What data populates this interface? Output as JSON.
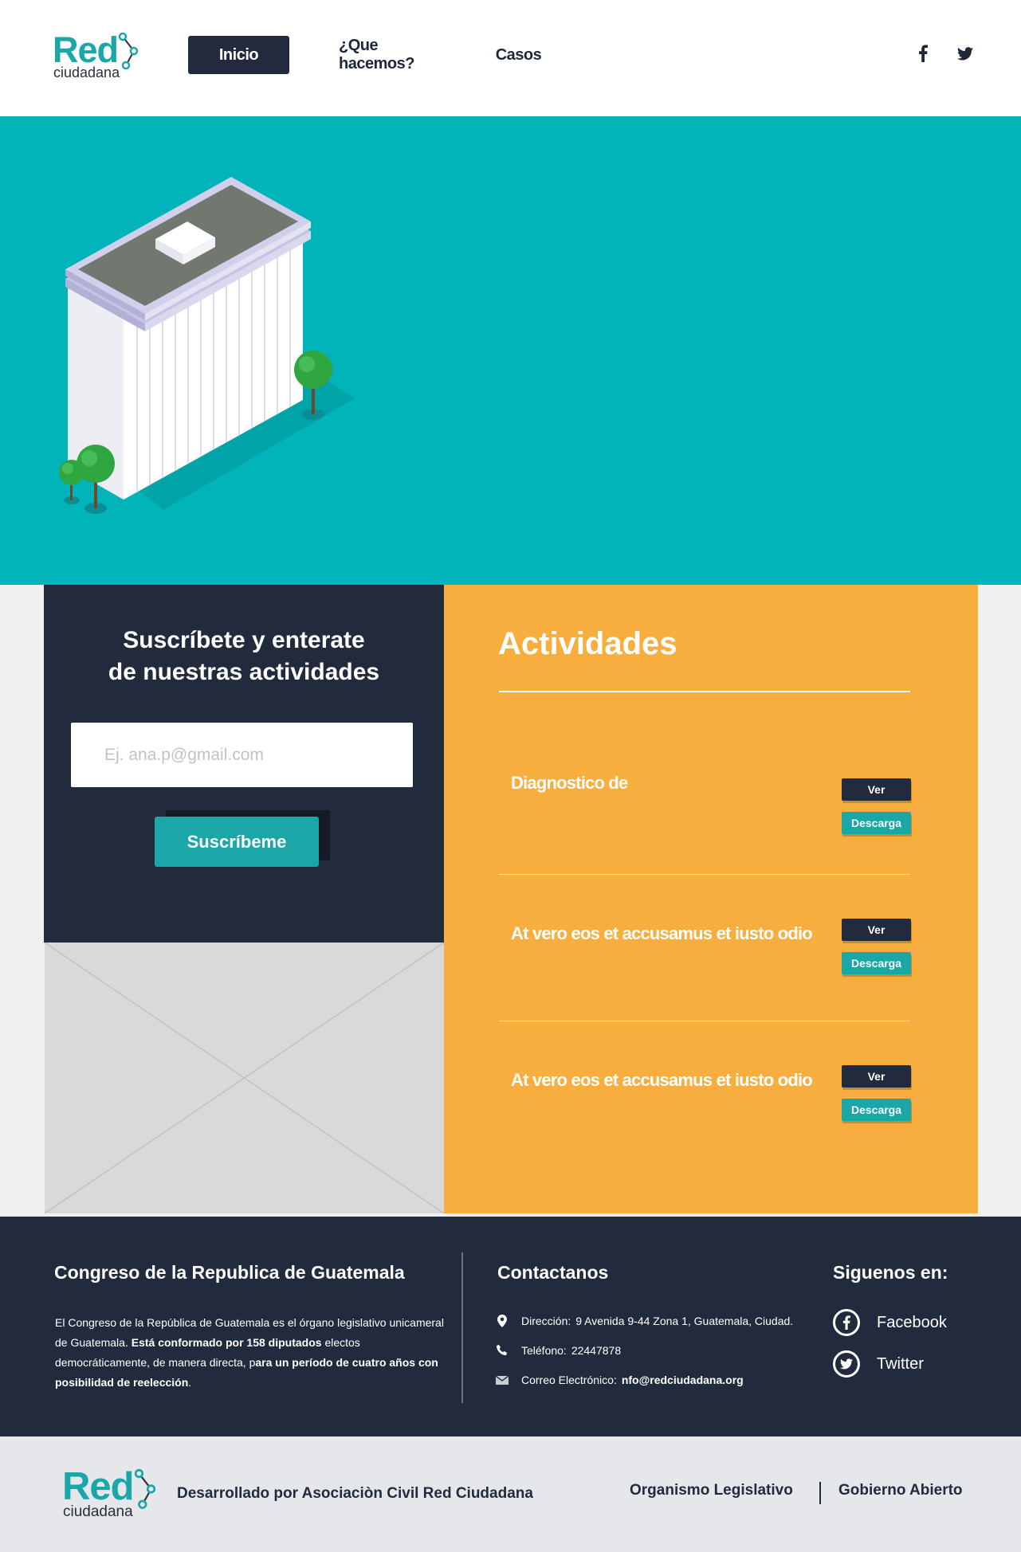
{
  "header": {
    "logo": {
      "word": "Red",
      "sub": "ciudadana"
    },
    "nav": [
      {
        "label": "Inicio",
        "active": true
      },
      {
        "label": "¿Que hacemos?",
        "active": false
      },
      {
        "label": "Casos",
        "active": false
      }
    ],
    "social": [
      {
        "icon": "facebook-icon"
      },
      {
        "icon": "twitter-icon"
      }
    ]
  },
  "hero": {
    "illustration": "isometric-building",
    "background": "#00b4b9"
  },
  "subscribe": {
    "title_line1": "Suscríbete  y enterate",
    "title_line2": "de nuestras actividades",
    "placeholder": "Ej. ana.p@gmail.com",
    "button": "Suscríbeme"
  },
  "activities": {
    "title": "Actividades",
    "items": [
      {
        "title": "Diagnostico de",
        "view_label": "Ver",
        "download_label": "Descarga"
      },
      {
        "title": "At vero eos et accusamus et iusto odio",
        "view_label": "Ver",
        "download_label": "Descarga"
      },
      {
        "title": "At vero eos et accusamus et iusto odio",
        "view_label": "Ver",
        "download_label": "Descarga"
      }
    ]
  },
  "footer": {
    "about": {
      "heading": "Congreso de la Republica de Guatemala",
      "text_1": "El Congreso de la República de Guatemala es el órgano legislativo unicameral de Guatemala. ",
      "bold_1": "Está conformado por 158 diputados",
      "text_2": " electos democráticamente, de manera directa, p",
      "bold_2": "ara un período de cuatro años con posibilidad de reelección",
      "text_3": "."
    },
    "contact": {
      "heading": "Contactanos",
      "rows": [
        {
          "icon": "location-pin-icon",
          "label": "Dirección:",
          "value": "9 Avenida 9-44 Zona 1, Guatemala, Ciudad."
        },
        {
          "icon": "phone-icon",
          "label": "Teléfono:",
          "value": "22447878"
        },
        {
          "icon": "mail-icon",
          "label": "Correo Electrónico:",
          "value": "nfo@redciudadana.org"
        }
      ]
    },
    "follow": {
      "heading": "Siguenos en:",
      "links": [
        {
          "icon": "facebook-icon",
          "label": "Facebook"
        },
        {
          "icon": "twitter-icon",
          "label": "Twitter"
        }
      ]
    }
  },
  "bottom": {
    "logo": {
      "word": "Red",
      "sub": "ciudadana"
    },
    "developed_by": "Desarrollado por Asociaciòn Civil Red Ciudadana",
    "links": [
      {
        "label": "Organismo Legislativo"
      },
      {
        "label": "Gobierno Abierto"
      }
    ]
  },
  "colors": {
    "navy": "#222b3d",
    "teal": "#1ba7a8",
    "hero_teal": "#00b4b9",
    "orange": "#f8ae3f",
    "light_gray": "#f0f0f0",
    "bottom_gray": "#e6e7ea"
  }
}
